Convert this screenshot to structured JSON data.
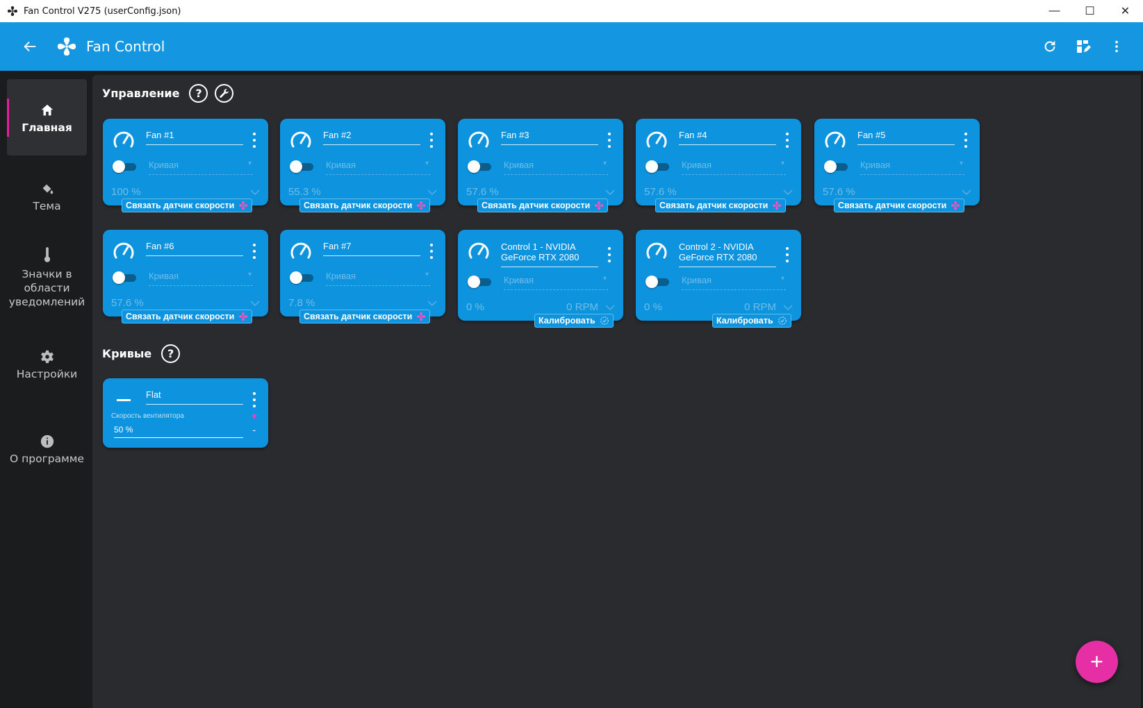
{
  "window": {
    "title": "Fan Control V275 (userConfig.json)",
    "minimize": "—",
    "maximize": "☐",
    "close": "✕"
  },
  "appbar": {
    "title": "Fan Control"
  },
  "sidebar": {
    "items": [
      {
        "label": "Главная",
        "icon": "home-icon",
        "active": true
      },
      {
        "label": "Тема",
        "icon": "paint-bucket-icon"
      },
      {
        "label": "Значки в области уведомлений",
        "icon": "thermometer-icon"
      },
      {
        "label": "Настройки",
        "icon": "gear-icon"
      },
      {
        "label": "О программе",
        "icon": "info-icon"
      }
    ]
  },
  "control_section": {
    "title": "Управление"
  },
  "fans": [
    {
      "name": "Fan #1",
      "curve_placeholder": "Кривая",
      "percent": "100 %",
      "action": "Связать датчик скорости"
    },
    {
      "name": "Fan #2",
      "curve_placeholder": "Кривая",
      "percent": "55.3 %",
      "action": "Связать датчик скорости"
    },
    {
      "name": "Fan #3",
      "curve_placeholder": "Кривая",
      "percent": "57.6 %",
      "action": "Связать датчик скорости"
    },
    {
      "name": "Fan #4",
      "curve_placeholder": "Кривая",
      "percent": "57.6 %",
      "action": "Связать датчик скорости"
    },
    {
      "name": "Fan #5",
      "curve_placeholder": "Кривая",
      "percent": "57.6 %",
      "action": "Связать датчик скорости"
    },
    {
      "name": "Fan #6",
      "curve_placeholder": "Кривая",
      "percent": "57.6 %",
      "action": "Связать датчик скорости"
    },
    {
      "name": "Fan #7",
      "curve_placeholder": "Кривая",
      "percent": "7.8 %",
      "action": "Связать датчик скорости"
    }
  ],
  "gpu_controls": [
    {
      "name": "Control 1 - NVIDIA GeForce RTX 2080",
      "curve_placeholder": "Кривая",
      "percent": "0 %",
      "rpm": "0 RPM",
      "action": "Калибровать"
    },
    {
      "name": "Control 2 - NVIDIA GeForce RTX 2080",
      "curve_placeholder": "Кривая",
      "percent": "0 %",
      "rpm": "0 RPM",
      "action": "Калибровать"
    }
  ],
  "curves_section": {
    "title": "Кривые"
  },
  "curves": [
    {
      "name": "Flat",
      "label": "Скорость вентилятора",
      "value": "50 %",
      "plus": "+",
      "minus": "-"
    }
  ],
  "fab": {
    "label": "+"
  },
  "colors": {
    "accent": "#1496e1",
    "card": "#0e94de",
    "fab": "#e62ea5",
    "indicator": "#e91e9b"
  }
}
